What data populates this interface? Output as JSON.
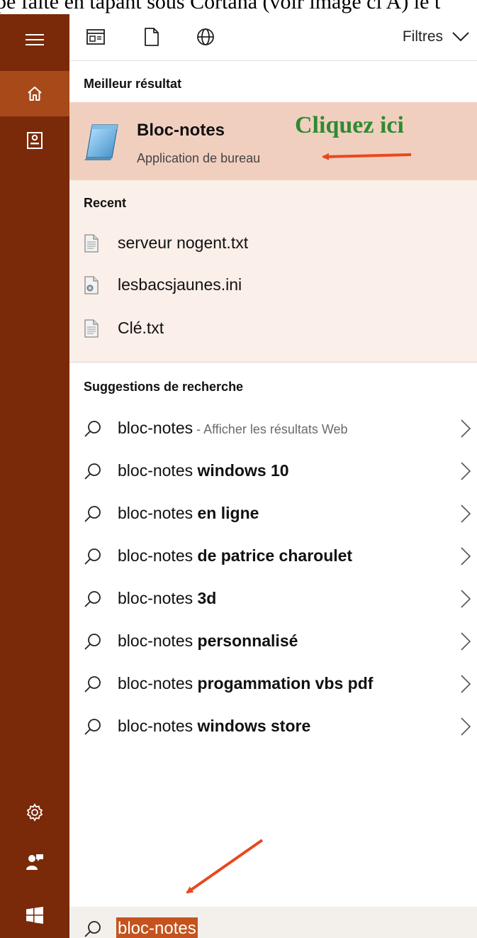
{
  "caption": {
    "text": "pe faite en tapant sous Cortana (voir image ci A) le t"
  },
  "rail": {
    "menu_icon": "hamburger-icon",
    "home_icon": "home-icon",
    "notebook_icon": "notebook-icon",
    "settings_icon": "gear-icon",
    "feedback_icon": "feedback-icon",
    "start_icon": "windows-logo-icon"
  },
  "toolbar": {
    "apps_icon": "apps-filter-icon",
    "documents_icon": "document-icon",
    "web_icon": "globe-icon",
    "filters_label": "Filtres"
  },
  "best_match": {
    "heading": "Meilleur résultat",
    "title": "Bloc-notes",
    "subtitle": "Application de bureau",
    "callout": "Cliquez ici"
  },
  "recent": {
    "heading": "Recent",
    "items": [
      {
        "label": "serveur nogent.txt",
        "icon": "text-file-icon"
      },
      {
        "label": "lesbacsjaunes.ini",
        "icon": "settings-file-icon"
      },
      {
        "label": "Clé.txt",
        "icon": "text-file-icon"
      }
    ]
  },
  "suggestions": {
    "heading": "Suggestions de recherche",
    "items": [
      {
        "prefix": "bloc-notes",
        "bold": "",
        "hint": " - Afficher les résultats Web"
      },
      {
        "prefix": "bloc-notes ",
        "bold": "windows 10",
        "hint": ""
      },
      {
        "prefix": "bloc-notes ",
        "bold": "en ligne",
        "hint": ""
      },
      {
        "prefix": "bloc-notes ",
        "bold": "de patrice charoulet",
        "hint": ""
      },
      {
        "prefix": "bloc-notes ",
        "bold": "3d",
        "hint": ""
      },
      {
        "prefix": "bloc-notes ",
        "bold": "personnalisé",
        "hint": ""
      },
      {
        "prefix": "bloc-notes ",
        "bold": "progammation vbs pdf",
        "hint": ""
      },
      {
        "prefix": "bloc-notes ",
        "bold": "windows store",
        "hint": ""
      }
    ]
  },
  "search": {
    "query": "bloc-notes"
  },
  "colors": {
    "rail_bg": "#7a2a08",
    "rail_active": "#a8491a",
    "best_bg": "#f1cfbf",
    "recent_bg": "#fbefe9",
    "callout_green": "#2f8a32",
    "arrow_red": "#e8491e",
    "selection": "#c4531d"
  }
}
